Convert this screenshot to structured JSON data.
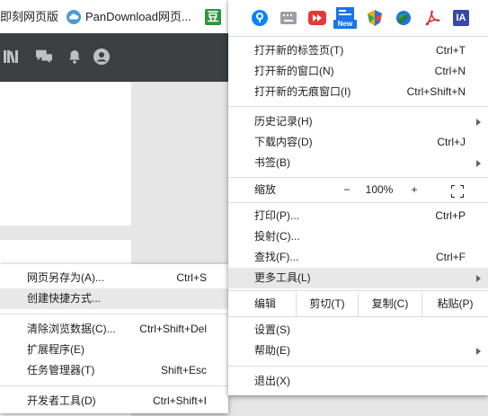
{
  "bookmarks": [
    {
      "label": "即刻网页版",
      "icon": "none"
    },
    {
      "label": "PanDownload网页...",
      "icon": "cloud-icon"
    },
    {
      "label": "豆",
      "icon": "douban-icon"
    }
  ],
  "extensions": [
    {
      "name": "1password-icon",
      "color": "#0a84ff"
    },
    {
      "name": "keyboard-icon",
      "color": "#9aa0a6"
    },
    {
      "name": "video-downloader-icon",
      "color": "#e53935"
    },
    {
      "name": "news-icon",
      "color": "#1a73e8",
      "badge": "New"
    },
    {
      "name": "multicolor-shield-icon",
      "color": "#f9ab00"
    },
    {
      "name": "globe-download-icon",
      "color": "#34a853"
    },
    {
      "name": "pdf-icon",
      "color": "#d93025"
    },
    {
      "name": "ia-icon",
      "color": "#3949ab",
      "text": "IA"
    }
  ],
  "menu": {
    "new_tab": {
      "label": "打开新的标签页(T)",
      "shortcut": "Ctrl+T"
    },
    "new_window": {
      "label": "打开新的窗口(N)",
      "shortcut": "Ctrl+N"
    },
    "new_incognito": {
      "label": "打开新的无痕窗口(I)",
      "shortcut": "Ctrl+Shift+N"
    },
    "history": {
      "label": "历史记录(H)"
    },
    "downloads": {
      "label": "下载内容(D)",
      "shortcut": "Ctrl+J"
    },
    "bookmarks": {
      "label": "书签(B)"
    },
    "zoom": {
      "label": "缩放",
      "minus": "−",
      "value": "100%",
      "plus": "+"
    },
    "print": {
      "label": "打印(P)...",
      "shortcut": "Ctrl+P"
    },
    "cast": {
      "label": "投射(C)..."
    },
    "find": {
      "label": "查找(F)...",
      "shortcut": "Ctrl+F"
    },
    "more_tools": {
      "label": "更多工具(L)"
    },
    "edit": {
      "label": "编辑",
      "cut": "剪切(T)",
      "copy": "复制(C)",
      "paste": "粘贴(P)"
    },
    "settings": {
      "label": "设置(S)"
    },
    "help": {
      "label": "帮助(E)"
    },
    "exit": {
      "label": "退出(X)"
    }
  },
  "submenu": {
    "save_page": {
      "label": "网页另存为(A)...",
      "shortcut": "Ctrl+S"
    },
    "create_shortcut": {
      "label": "创建快捷方式..."
    },
    "clear_data": {
      "label": "清除浏览数据(C)...",
      "shortcut": "Ctrl+Shift+Del"
    },
    "extensions": {
      "label": "扩展程序(E)"
    },
    "task_manager": {
      "label": "任务管理器(T)",
      "shortcut": "Shift+Esc"
    },
    "dev_tools": {
      "label": "开发者工具(D)",
      "shortcut": "Ctrl+Shift+I"
    }
  }
}
